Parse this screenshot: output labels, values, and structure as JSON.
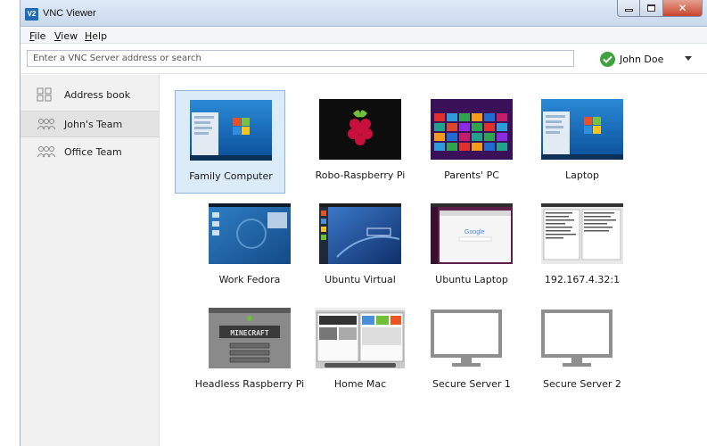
{
  "window": {
    "title": "VNC Viewer",
    "logo_text": "V2"
  },
  "menu": [
    {
      "label": "File",
      "ul": "F",
      "rest": "ile"
    },
    {
      "label": "View",
      "ul": "V",
      "rest": "iew"
    },
    {
      "label": "Help",
      "ul": "H",
      "rest": "elp"
    }
  ],
  "toolbar": {
    "search_placeholder": "Enter a VNC Server address or search",
    "user_name": "John Doe"
  },
  "sidebar": {
    "items": [
      {
        "label": "Address book",
        "icon": "address-book-icon"
      },
      {
        "label": "John's Team",
        "icon": "team-icon",
        "selected": true
      },
      {
        "label": "Office Team",
        "icon": "team-icon"
      }
    ]
  },
  "computers": [
    {
      "label": "Family Computer",
      "thumb": "win7",
      "selected": true
    },
    {
      "label": "Robo-Raspberry Pi",
      "thumb": "raspberry"
    },
    {
      "label": "Parents' PC",
      "thumb": "win8"
    },
    {
      "label": "Laptop",
      "thumb": "win7"
    },
    {
      "label": "Work Fedora",
      "thumb": "fedora"
    },
    {
      "label": "Ubuntu Virtual",
      "thumb": "ubuntu-virtual"
    },
    {
      "label": "Ubuntu Laptop",
      "thumb": "ubuntu-laptop"
    },
    {
      "label": "192.167.4.32:1",
      "thumb": "terminal"
    },
    {
      "label": "Headless Raspberry Pi",
      "thumb": "minecraft"
    },
    {
      "label": "Home Mac",
      "thumb": "mac"
    },
    {
      "label": "Secure Server 1",
      "thumb": "monitor-placeholder"
    },
    {
      "label": "Secure Server 2",
      "thumb": "monitor-placeholder"
    }
  ],
  "colors": {
    "accent": "#1f6bb5",
    "selected_tile": "#dcebf8",
    "status_ok": "#3ea33e"
  }
}
